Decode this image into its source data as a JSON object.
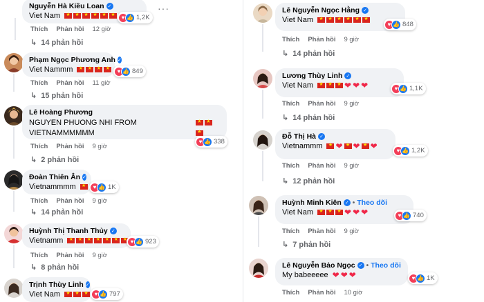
{
  "left": [
    {
      "name": "Nguyễn Hà Kiều Loan",
      "verified": true,
      "text": "Viet Nam",
      "emojis": [
        "flag",
        "flag",
        "flag",
        "flag",
        "flag",
        "flag"
      ],
      "reaction_count": "1,2K",
      "like": "Thích",
      "reply": "Phản hồi",
      "time": "12 giờ",
      "replies": "14 phản hồi"
    },
    {
      "name": "Phạm Ngọc Phương Anh",
      "verified": true,
      "text": "Viet Nammm",
      "emojis": [
        "flag",
        "flag",
        "flag",
        "flag"
      ],
      "reaction_count": "849",
      "like": "Thích",
      "reply": "Phản hồi",
      "time": "11 giờ",
      "replies": "15 phản hồi"
    },
    {
      "name": "Lê Hoàng Phương",
      "verified": false,
      "text": "NGUYEN PHUONG NHI FROM VIETNAMMMMMM",
      "emojis": [
        "flag",
        "flag",
        "flag"
      ],
      "reaction_count": "338",
      "like": "Thích",
      "reply": "Phản hồi",
      "time": "9 giờ",
      "replies": "2 phản hồi"
    },
    {
      "name": "Đoàn Thiên Ân",
      "verified": true,
      "text": "Vietnammmm",
      "emojis": [
        "flag"
      ],
      "reaction_count": "1K",
      "like": "Thích",
      "reply": "Phản hồi",
      "time": "9 giờ",
      "replies": "14 phản hồi"
    },
    {
      "name": "Huỳnh Thị Thanh Thủy",
      "verified": true,
      "text": "Vietnamm",
      "emojis": [
        "flag",
        "flag",
        "flag",
        "flag",
        "flag",
        "flag",
        "flag"
      ],
      "reaction_count": "923",
      "like": "Thích",
      "reply": "Phản hồi",
      "time": "9 giờ",
      "replies": "8 phản hồi"
    },
    {
      "name": "Trịnh Thùy Linh",
      "verified": true,
      "text": "Viet Nam",
      "emojis": [
        "flag",
        "flag",
        "flag"
      ],
      "reaction_count": "797"
    }
  ],
  "right": [
    {
      "name": "Lê Nguyễn Ngọc Hằng",
      "verified": true,
      "text": "Viet Nam",
      "emojis": [
        "flag",
        "flag",
        "flag",
        "flag",
        "flag",
        "flag"
      ],
      "reaction_count": "848",
      "like": "Thích",
      "reply": "Phản hồi",
      "time": "9 giờ",
      "replies": "14 phản hồi"
    },
    {
      "name": "Lương Thùy Linh",
      "verified": true,
      "text": "Viet Nam",
      "emojis": [
        "flag",
        "flag",
        "flag",
        "heart",
        "heart",
        "heart"
      ],
      "reaction_count": "1,1K",
      "like": "Thích",
      "reply": "Phản hồi",
      "time": "9 giờ",
      "replies": "14 phản hồi"
    },
    {
      "name": "Đỗ Thị Hà",
      "verified": true,
      "text": "Vietnammm",
      "emojis": [
        "flag",
        "heart",
        "flag",
        "heart",
        "flag",
        "heart"
      ],
      "reaction_count": "1,2K",
      "like": "Thích",
      "reply": "Phản hồi",
      "time": "9 giờ",
      "replies": "12 phản hồi"
    },
    {
      "name": "Huỳnh Minh Kiên",
      "verified": true,
      "follow": "Theo dõi",
      "text": "Viet Nam",
      "emojis": [
        "flag",
        "flag",
        "flag",
        "heart",
        "heart",
        "heart"
      ],
      "reaction_count": "740",
      "like": "Thích",
      "reply": "Phản hồi",
      "time": "9 giờ",
      "replies": "7 phản hồi"
    },
    {
      "name": "Lê Nguyễn Bảo Ngọc",
      "verified": true,
      "follow": "Theo dõi",
      "text": "My babeeeee",
      "emojis": [
        "heart",
        "heart",
        "heart"
      ],
      "reaction_count": "1K",
      "like": "Thích",
      "reply": "Phản hồi",
      "time": "10 giờ"
    }
  ],
  "icons": {
    "verified": "✓",
    "more": "···",
    "reply_arrow": "↳",
    "follow_dot": "•"
  }
}
